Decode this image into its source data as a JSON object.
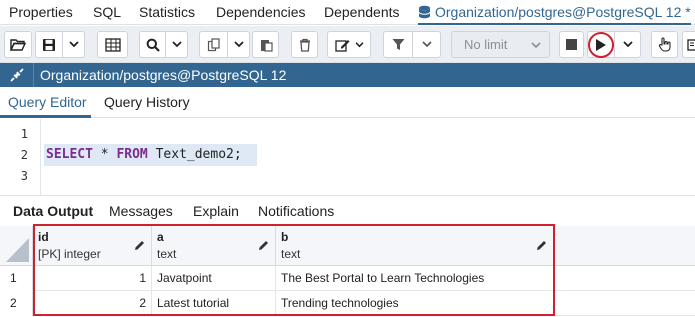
{
  "tabbar": {
    "tabs": [
      "Properties",
      "SQL",
      "Statistics",
      "Dependencies",
      "Dependents"
    ],
    "active_tab": "Organization/postgres@PostgreSQL 12 *"
  },
  "toolbar": {
    "limit_value": "No limit"
  },
  "connection": {
    "label": "Organization/postgres@PostgreSQL 12"
  },
  "editor_tabs": [
    "Query Editor",
    "Query History"
  ],
  "editor": {
    "line_numbers": [
      "1",
      "2",
      "3"
    ],
    "keyword_select": "SELECT",
    "star": " * ",
    "keyword_from": "FROM",
    "rest": " Text_demo2;"
  },
  "output_tabs": [
    "Data Output",
    "Messages",
    "Explain",
    "Notifications"
  ],
  "grid": {
    "columns": [
      {
        "name": "id",
        "type": "[PK] integer"
      },
      {
        "name": "a",
        "type": "text"
      },
      {
        "name": "b",
        "type": "text"
      }
    ],
    "rows": [
      {
        "num": "1",
        "id": "1",
        "a": "Javatpoint",
        "b": "The Best Portal to Learn Technologies"
      },
      {
        "num": "2",
        "id": "2",
        "a": "Latest tutorial",
        "b": "Trending technologies"
      }
    ]
  },
  "colors": {
    "accent": "#326690",
    "highlight": "#d0202e"
  }
}
